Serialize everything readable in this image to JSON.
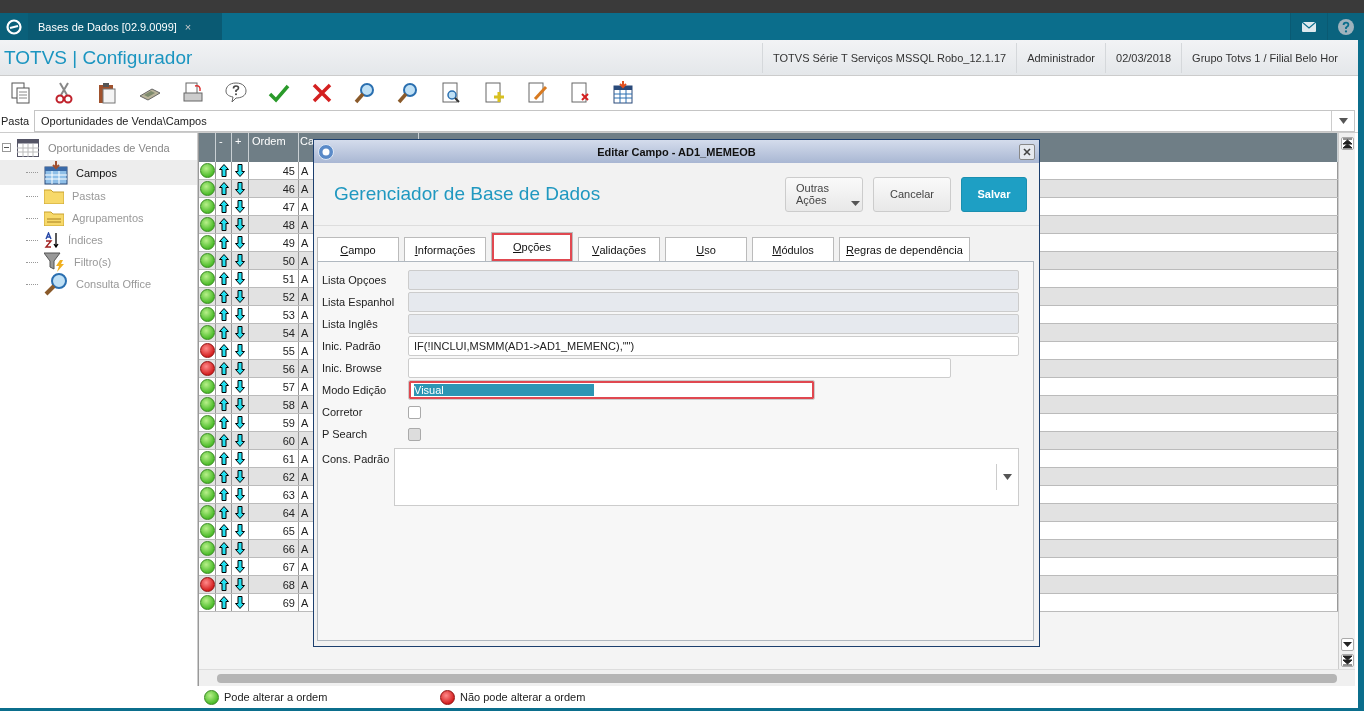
{
  "app_tab": {
    "title": "Bases de Dados [02.9.0099]",
    "close": "×"
  },
  "header": {
    "title": "TOTVS | Configurador",
    "info": [
      "TOTVS Série T Serviços MSSQL Robo_12.1.17",
      "Administrador",
      "02/03/2018",
      "Grupo Totvs 1 / Filial Belo Hor"
    ]
  },
  "folder": {
    "label": "Pasta",
    "value": "Oportunidades de Venda\\Campos"
  },
  "tree": {
    "label": "Oportunidades de Venda",
    "expanded": true,
    "children": [
      {
        "label": "Campos",
        "selected": true
      },
      {
        "label": "Pastas",
        "selected": false
      },
      {
        "label": "Agrupamentos",
        "selected": false
      },
      {
        "label": "Índices",
        "selected": false
      },
      {
        "label": "Filtro(s)",
        "selected": false
      },
      {
        "label": "Consulta Office",
        "selected": false
      }
    ]
  },
  "grid": {
    "columns": [
      "-",
      "+",
      "Ordem",
      "Ca"
    ],
    "rows": [
      {
        "movable": true,
        "order": "45",
        "field": "A"
      },
      {
        "movable": true,
        "order": "46",
        "field": "A"
      },
      {
        "movable": true,
        "order": "47",
        "field": "A"
      },
      {
        "movable": true,
        "order": "48",
        "field": "A"
      },
      {
        "movable": true,
        "order": "49",
        "field": "A"
      },
      {
        "movable": true,
        "order": "50",
        "field": "A"
      },
      {
        "movable": true,
        "order": "51",
        "field": "A"
      },
      {
        "movable": true,
        "order": "52",
        "field": "A"
      },
      {
        "movable": true,
        "order": "53",
        "field": "A"
      },
      {
        "movable": true,
        "order": "54",
        "field": "A"
      },
      {
        "movable": false,
        "order": "55",
        "field": "A"
      },
      {
        "movable": false,
        "order": "56",
        "field": "A"
      },
      {
        "movable": true,
        "order": "57",
        "field": "A"
      },
      {
        "movable": true,
        "order": "58",
        "field": "A"
      },
      {
        "movable": true,
        "order": "59",
        "field": "A"
      },
      {
        "movable": true,
        "order": "60",
        "field": "A"
      },
      {
        "movable": true,
        "order": "61",
        "field": "A"
      },
      {
        "movable": true,
        "order": "62",
        "field": "A"
      },
      {
        "movable": true,
        "order": "63",
        "field": "A"
      },
      {
        "movable": true,
        "order": "64",
        "field": "A"
      },
      {
        "movable": true,
        "order": "65",
        "field": "A"
      },
      {
        "movable": true,
        "order": "66",
        "field": "A"
      },
      {
        "movable": true,
        "order": "67",
        "field": "A"
      },
      {
        "movable": false,
        "order": "68",
        "field": "A"
      },
      {
        "movable": true,
        "order": "69",
        "field": "A"
      }
    ]
  },
  "dialog": {
    "title": "Editar Campo - AD1_MEMEOB",
    "heading": "Gerenciador de Base de Dados",
    "buttons": [
      {
        "label": "Outras Ações",
        "kind": "menu"
      },
      {
        "label": "Cancelar",
        "kind": "secondary"
      },
      {
        "label": "Salvar",
        "kind": "primary"
      }
    ],
    "tabs": [
      {
        "label": "Campo",
        "selected": false,
        "highlighted": false
      },
      {
        "label": "Informações",
        "selected": false,
        "highlighted": false
      },
      {
        "label": "Opções",
        "selected": true,
        "highlighted": true
      },
      {
        "label": "Validações",
        "selected": false,
        "highlighted": false
      },
      {
        "label": "Uso",
        "selected": false,
        "highlighted": false
      },
      {
        "label": "Módulos",
        "selected": false,
        "highlighted": false
      },
      {
        "label": "Regras de dependência",
        "selected": false,
        "highlighted": false
      }
    ],
    "fields": [
      {
        "kind": "text",
        "label": "Lista Opçoes",
        "disabled": true
      },
      {
        "kind": "text",
        "label": "Lista Espanhol",
        "disabled": true
      },
      {
        "kind": "text",
        "label": "Lista Inglês",
        "disabled": true
      },
      {
        "kind": "text",
        "label": "Inic. Padrão",
        "disabled": false,
        "value": "IF(!INCLUI,MSMM(AD1->AD1_MEMENC),\"\")"
      },
      {
        "kind": "text",
        "label": "Inic. Browse",
        "disabled": false
      },
      {
        "kind": "text",
        "label": "Modo Edição",
        "disabled": false,
        "value": "Visual",
        "text_selected": true,
        "highlighted": true
      },
      {
        "kind": "checkbox",
        "label": "Corretor",
        "checked": false,
        "disabled": false
      },
      {
        "kind": "checkbox",
        "label": "P Search",
        "checked": false,
        "disabled": true
      },
      {
        "kind": "combo",
        "label": "Cons. Padrão",
        "disabled": false
      }
    ]
  },
  "legend": [
    {
      "label": "Pode alterar a ordem",
      "movable": true
    },
    {
      "label": "Não pode alterar a ordem",
      "movable": false
    }
  ]
}
